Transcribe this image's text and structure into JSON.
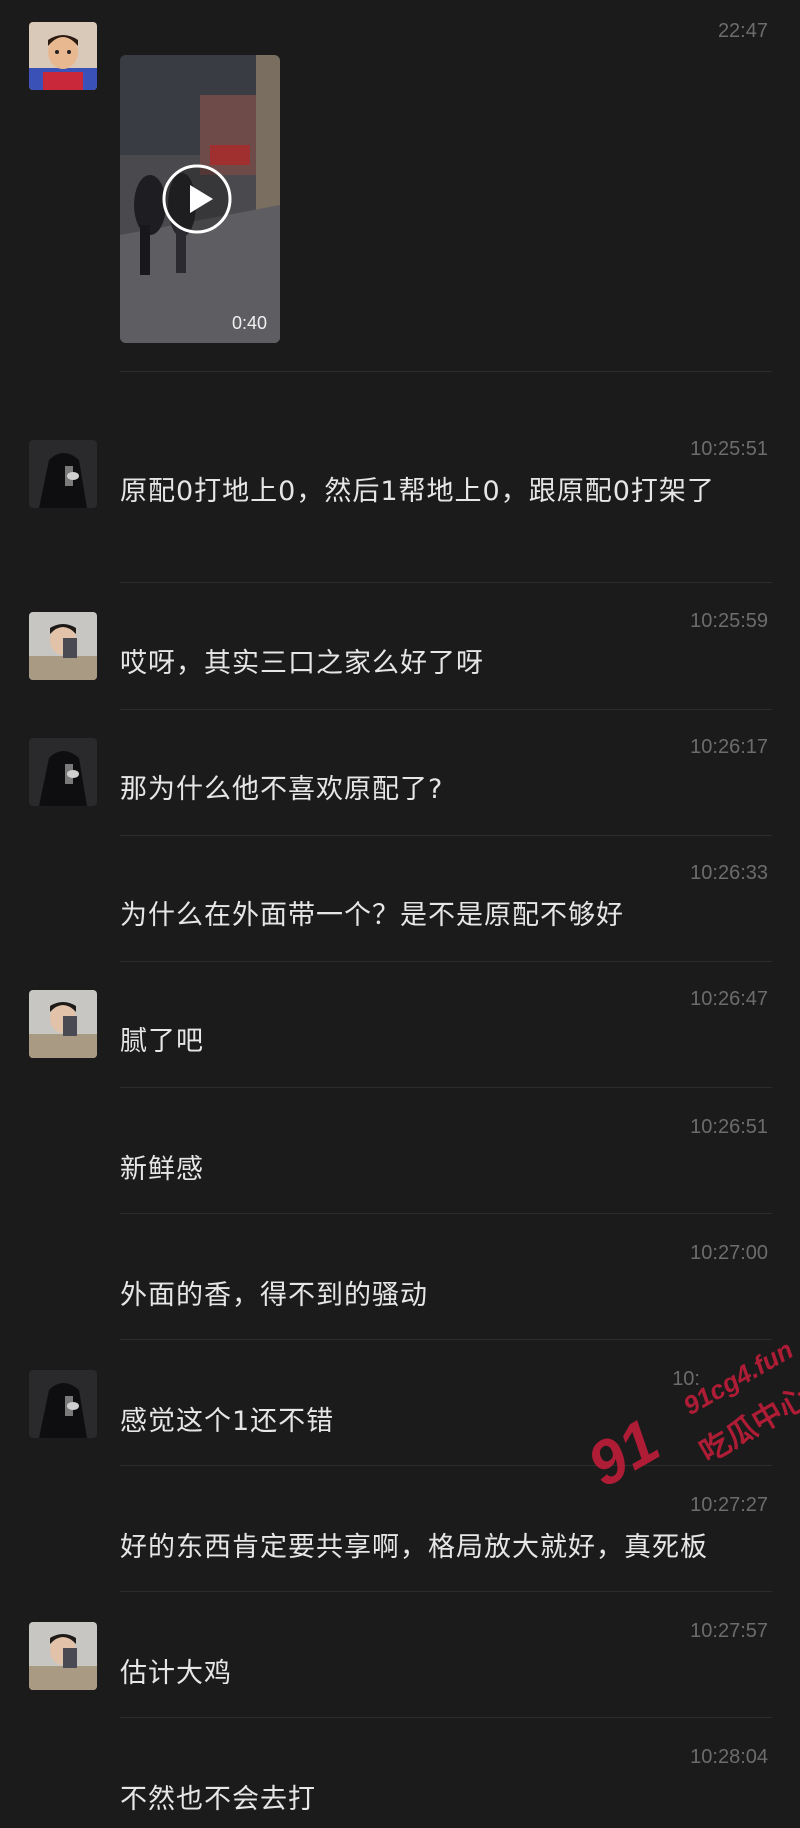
{
  "messages": [
    {
      "sender": "child-avatar",
      "time": "22:47",
      "type": "video",
      "duration": "0:40"
    },
    {
      "sender": "dark-avatar",
      "time": "10:25:51",
      "text": "原配0打地上0，然后1帮地上0，跟原配0打架了"
    },
    {
      "sender": "selfie-avatar",
      "time": "10:25:59",
      "text": "哎呀，其实三口之家么好了呀"
    },
    {
      "sender": "dark-avatar",
      "time": "10:26:17",
      "text": "那为什么他不喜欢原配了?"
    },
    {
      "sender": "",
      "time": "10:26:33",
      "text": "为什么在外面带一个？是不是原配不够好"
    },
    {
      "sender": "selfie-avatar",
      "time": "10:26:47",
      "text": "腻了吧"
    },
    {
      "sender": "",
      "time": "10:26:51",
      "text": "新鲜感"
    },
    {
      "sender": "",
      "time": "10:27:00",
      "text": "外面的香，得不到的骚动"
    },
    {
      "sender": "dark-avatar",
      "time": "10:",
      "text": "感觉这个1还不错"
    },
    {
      "sender": "",
      "time": "10:27:27",
      "text": "好的东西肯定要共享啊，格局放大就好，真死板"
    },
    {
      "sender": "selfie-avatar",
      "time": "10:27:57",
      "text": "估计大鸡"
    },
    {
      "sender": "",
      "time": "10:28:04",
      "text": "不然也不会去打"
    }
  ],
  "watermark": {
    "number": "91",
    "site": "91cg4.fun",
    "name": "吃瓜中心",
    "color": "#c81e3a"
  },
  "colors": {
    "background": "#1b1b1c",
    "text": "#e6e6e6",
    "timestamp": "#6c6c6c",
    "divider": "#2c2c2d"
  }
}
